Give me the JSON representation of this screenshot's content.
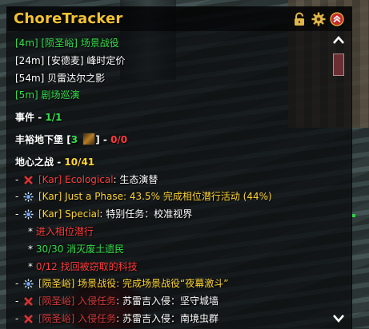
{
  "window": {
    "title": "ChoreTracker"
  },
  "header_icons": {
    "lock": "lock-icon",
    "settings": "gear-icon",
    "collapse": "collapse-icon"
  },
  "timers": [
    {
      "time": "[4m]",
      "label": "[陨圣峪] 场景战役",
      "color": "#33e04a"
    },
    {
      "time": "[24m]",
      "label": "[安德麦] 峰时定价",
      "color": "#ffffff"
    },
    {
      "time": "[54m]",
      "label": "贝雷达尔之影",
      "color": "#ffffff"
    },
    {
      "time": "[5m]",
      "label": "剧场巡演",
      "color": "#33e04a"
    }
  ],
  "events": {
    "label": "事件",
    "sep": " - ",
    "value": "1/1"
  },
  "dungeon": {
    "label": "丰裕地下堡",
    "bracket_open": "[",
    "count": "3",
    "bracket_close": "]",
    "sep": " - ",
    "value": "0/0"
  },
  "war": {
    "label": "地心之战",
    "sep": " - ",
    "value": "10/41"
  },
  "quests": [
    {
      "bullet": "- ",
      "icon": "red-x-icon",
      "tag": "[Kar] Ecological",
      "colon": ": ",
      "text": "生态演替",
      "tag_color": "#ff3b3b",
      "text_color": "#ffffff"
    },
    {
      "bullet": "- ",
      "icon": "in-progress-icon",
      "tag": "[Kar] Just a Phase",
      "colon": ": ",
      "text": "43.5% 完成相位潜行活动 (44%)",
      "tag_color": "#ffd633",
      "text_color": "#ffd633"
    },
    {
      "bullet": "- ",
      "icon": "in-progress-icon",
      "tag": "[Kar] Special",
      "colon": ": ",
      "text": "特别任务：校准视界",
      "tag_color": "#ffd633",
      "text_color": "#ffffff"
    }
  ],
  "subtasks": [
    {
      "bullet": "* ",
      "text": "进入相位潜行",
      "color": "#ff3b3b"
    },
    {
      "bullet": "* ",
      "text": "30/30 消灭废土遗民",
      "color": "#33e04a"
    },
    {
      "bullet": "* ",
      "text": "0/12 找回被窃取的科技",
      "color": "#ff3b3b"
    }
  ],
  "quests2": [
    {
      "bullet": "- ",
      "icon": "in-progress-icon",
      "tag": "[陨圣峪] 场景战役",
      "colon": ": ",
      "text": "完成场景战役“夜幕激斗”",
      "tag_color": "#ffd633",
      "text_color": "#ffd633"
    },
    {
      "bullet": "- ",
      "icon": "red-x-icon",
      "tag": "[陨圣峪] 入侵任务",
      "colon": ": ",
      "text": "苏雷吉入侵：坚守城墙",
      "tag_color": "#d23a3a",
      "text_color": "#ffffff"
    },
    {
      "bullet": "- ",
      "icon": "red-x-icon",
      "tag": "[陨圣峪] 入侵任务",
      "colon": ": ",
      "text": "苏雷吉入侵：南境虫群",
      "tag_color": "#d23a3a",
      "text_color": "#ffffff"
    }
  ],
  "colors": {
    "title": "#f2c233",
    "complete": "#33e04a",
    "progress": "#ffd633",
    "incomplete": "#ff3b3b"
  }
}
